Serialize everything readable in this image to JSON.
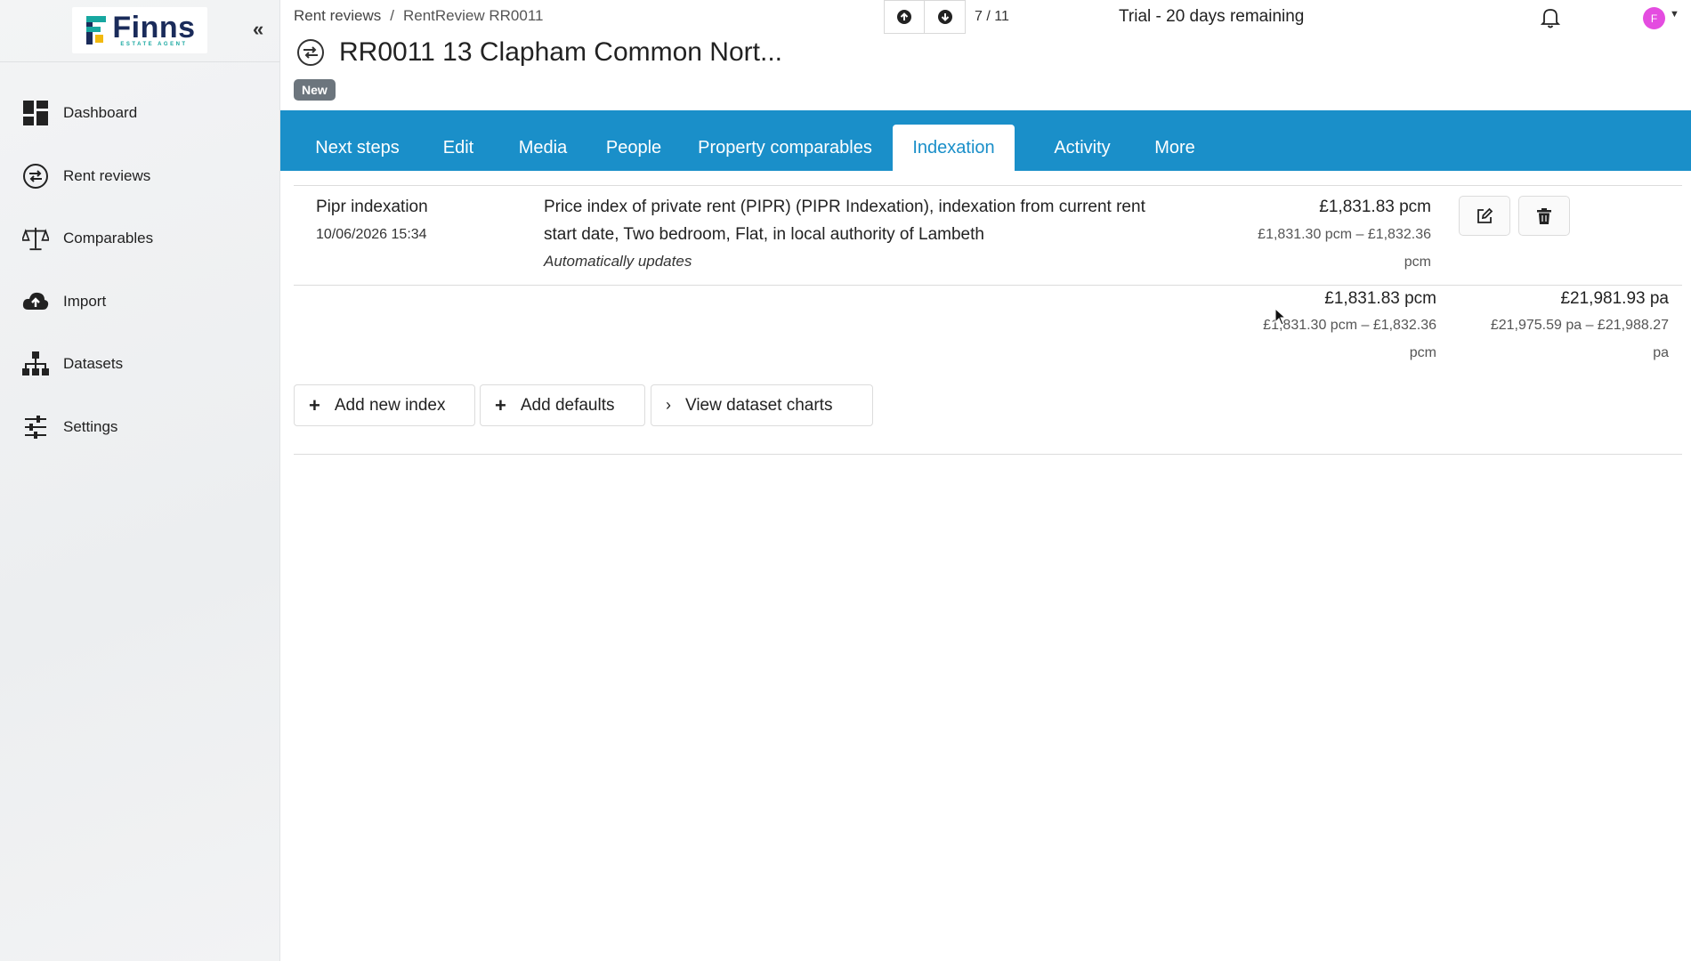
{
  "sidebar": {
    "logo": {
      "name": "Finns",
      "sub": "ESTATE AGENT"
    },
    "collapse_glyph": "«",
    "items": [
      {
        "label": "Dashboard",
        "icon": "dashboard-icon"
      },
      {
        "label": "Rent reviews",
        "icon": "rent-review-icon"
      },
      {
        "label": "Comparables",
        "icon": "scales-icon"
      },
      {
        "label": "Import",
        "icon": "cloud-upload-icon"
      },
      {
        "label": "Datasets",
        "icon": "hierarchy-icon"
      },
      {
        "label": "Settings",
        "icon": "sliders-icon"
      }
    ]
  },
  "header": {
    "breadcrumb": [
      "Rent reviews",
      "/",
      "RentReview RR0011"
    ],
    "pager": {
      "position": "7 / 11"
    },
    "trial": "Trial - 20 days remaining",
    "avatar_initial": "F",
    "title": "RR0011 13 Clapham Common Nort...",
    "badge": "New"
  },
  "tabs": [
    {
      "label": "Next steps"
    },
    {
      "label": "Edit"
    },
    {
      "label": "Media"
    },
    {
      "label": "People"
    },
    {
      "label": "Property comparables"
    },
    {
      "label": "Indexation",
      "active": true
    },
    {
      "label": "Activity"
    },
    {
      "label": "More"
    }
  ],
  "indexation": {
    "row": {
      "name": "Pipr indexation",
      "date": "10/06/2026 15:34",
      "description_line1": "Price index of private rent (PIPR) (PIPR Indexation), indexation from current rent",
      "description_line2": "start date, Two bedroom, Flat, in local authority of Lambeth",
      "auto": "Automatically updates",
      "value": "£1,831.83 pcm",
      "range_line1": "£1,831.30 pcm – £1,832.36",
      "range_line2": "pcm"
    },
    "summary": {
      "pcm_value": "£1,831.83 pcm",
      "pcm_range_line1": "£1,831.30 pcm – £1,832.36",
      "pcm_range_line2": "pcm",
      "pa_value": "£21,981.93 pa",
      "pa_range_line1": "£21,975.59 pa – £21,988.27",
      "pa_range_line2": "pa"
    },
    "actions": {
      "add_new_index": "Add new index",
      "add_defaults": "Add defaults",
      "view_dataset_charts": "View dataset charts"
    }
  },
  "colors": {
    "accent": "#1a8fc9",
    "badge": "#6c757d",
    "avatar": "#e44ce0",
    "brand_navy": "#1a2b5a",
    "brand_teal": "#17a7a0"
  }
}
